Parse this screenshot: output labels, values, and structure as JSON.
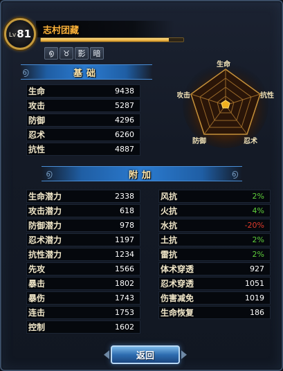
{
  "header": {
    "level_prefix": "Lv",
    "level": "81",
    "name": "志村团藏",
    "exp_progress": 0.9,
    "buff_icons": [
      {
        "icon": "swirl-icon",
        "glyph": "൭"
      },
      {
        "icon": "horns-icon",
        "glyph": "♉"
      },
      {
        "icon": "shadow-char",
        "glyph": "影"
      },
      {
        "icon": "dark-char",
        "glyph": "暗"
      }
    ]
  },
  "basic": {
    "title": "基础",
    "stats": [
      {
        "label": "生命",
        "value": "9438"
      },
      {
        "label": "攻击",
        "value": "5287"
      },
      {
        "label": "防御",
        "value": "4296"
      },
      {
        "label": "忍术",
        "value": "6260"
      },
      {
        "label": "抗性",
        "value": "4887"
      }
    ]
  },
  "radar": {
    "labels": {
      "top": "生命",
      "right": "抗性",
      "bottom_right": "忍术",
      "bottom_left": "防御",
      "left": "攻击"
    },
    "accent": "#f0b020"
  },
  "additional": {
    "title": "附加",
    "left": [
      {
        "label": "生命潜力",
        "value": "2338"
      },
      {
        "label": "攻击潜力",
        "value": "618"
      },
      {
        "label": "防御潜力",
        "value": "978"
      },
      {
        "label": "忍术潜力",
        "value": "1197"
      },
      {
        "label": "抗性潜力",
        "value": "1234"
      },
      {
        "label": "先攻",
        "value": "1566"
      },
      {
        "label": "暴击",
        "value": "1802"
      },
      {
        "label": "暴伤",
        "value": "1743"
      },
      {
        "label": "连击",
        "value": "1753"
      },
      {
        "label": "控制",
        "value": "1602"
      }
    ],
    "right": [
      {
        "label": "风抗",
        "value": "2%",
        "tone": "green"
      },
      {
        "label": "火抗",
        "value": "4%",
        "tone": "green"
      },
      {
        "label": "水抗",
        "value": "-20%",
        "tone": "red"
      },
      {
        "label": "土抗",
        "value": "2%",
        "tone": "green"
      },
      {
        "label": "雷抗",
        "value": "2%",
        "tone": "green"
      },
      {
        "label": "体术穿透",
        "value": "927",
        "tone": "white"
      },
      {
        "label": "忍术穿透",
        "value": "1051",
        "tone": "white"
      },
      {
        "label": "伤害减免",
        "value": "1019",
        "tone": "white"
      },
      {
        "label": "生命恢复",
        "value": "186",
        "tone": "white"
      }
    ]
  },
  "back_button": {
    "label": "返回"
  },
  "colors": {
    "name": "#ffb43a",
    "positive": "#5fcf3b",
    "negative": "#e03a2a",
    "banner": "#2b7bd0"
  }
}
